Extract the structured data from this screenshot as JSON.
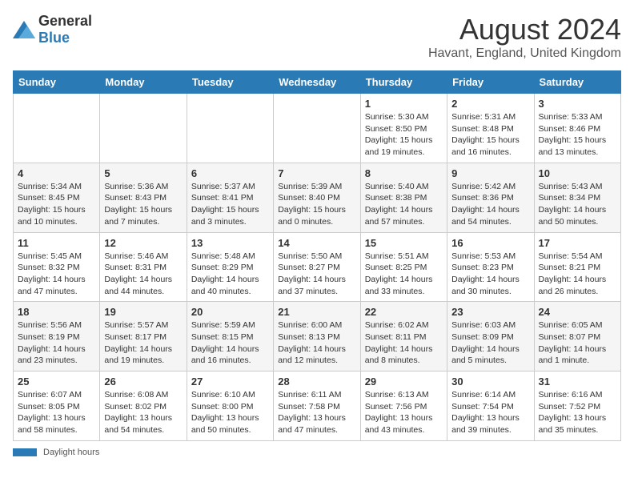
{
  "logo": {
    "general": "General",
    "blue": "Blue"
  },
  "title": "August 2024",
  "location": "Havant, England, United Kingdom",
  "days_of_week": [
    "Sunday",
    "Monday",
    "Tuesday",
    "Wednesday",
    "Thursday",
    "Friday",
    "Saturday"
  ],
  "weeks": [
    [
      {
        "day": "",
        "info": ""
      },
      {
        "day": "",
        "info": ""
      },
      {
        "day": "",
        "info": ""
      },
      {
        "day": "",
        "info": ""
      },
      {
        "day": "1",
        "info": "Sunrise: 5:30 AM\nSunset: 8:50 PM\nDaylight: 15 hours\nand 19 minutes."
      },
      {
        "day": "2",
        "info": "Sunrise: 5:31 AM\nSunset: 8:48 PM\nDaylight: 15 hours\nand 16 minutes."
      },
      {
        "day": "3",
        "info": "Sunrise: 5:33 AM\nSunset: 8:46 PM\nDaylight: 15 hours\nand 13 minutes."
      }
    ],
    [
      {
        "day": "4",
        "info": "Sunrise: 5:34 AM\nSunset: 8:45 PM\nDaylight: 15 hours\nand 10 minutes."
      },
      {
        "day": "5",
        "info": "Sunrise: 5:36 AM\nSunset: 8:43 PM\nDaylight: 15 hours\nand 7 minutes."
      },
      {
        "day": "6",
        "info": "Sunrise: 5:37 AM\nSunset: 8:41 PM\nDaylight: 15 hours\nand 3 minutes."
      },
      {
        "day": "7",
        "info": "Sunrise: 5:39 AM\nSunset: 8:40 PM\nDaylight: 15 hours\nand 0 minutes."
      },
      {
        "day": "8",
        "info": "Sunrise: 5:40 AM\nSunset: 8:38 PM\nDaylight: 14 hours\nand 57 minutes."
      },
      {
        "day": "9",
        "info": "Sunrise: 5:42 AM\nSunset: 8:36 PM\nDaylight: 14 hours\nand 54 minutes."
      },
      {
        "day": "10",
        "info": "Sunrise: 5:43 AM\nSunset: 8:34 PM\nDaylight: 14 hours\nand 50 minutes."
      }
    ],
    [
      {
        "day": "11",
        "info": "Sunrise: 5:45 AM\nSunset: 8:32 PM\nDaylight: 14 hours\nand 47 minutes."
      },
      {
        "day": "12",
        "info": "Sunrise: 5:46 AM\nSunset: 8:31 PM\nDaylight: 14 hours\nand 44 minutes."
      },
      {
        "day": "13",
        "info": "Sunrise: 5:48 AM\nSunset: 8:29 PM\nDaylight: 14 hours\nand 40 minutes."
      },
      {
        "day": "14",
        "info": "Sunrise: 5:50 AM\nSunset: 8:27 PM\nDaylight: 14 hours\nand 37 minutes."
      },
      {
        "day": "15",
        "info": "Sunrise: 5:51 AM\nSunset: 8:25 PM\nDaylight: 14 hours\nand 33 minutes."
      },
      {
        "day": "16",
        "info": "Sunrise: 5:53 AM\nSunset: 8:23 PM\nDaylight: 14 hours\nand 30 minutes."
      },
      {
        "day": "17",
        "info": "Sunrise: 5:54 AM\nSunset: 8:21 PM\nDaylight: 14 hours\nand 26 minutes."
      }
    ],
    [
      {
        "day": "18",
        "info": "Sunrise: 5:56 AM\nSunset: 8:19 PM\nDaylight: 14 hours\nand 23 minutes."
      },
      {
        "day": "19",
        "info": "Sunrise: 5:57 AM\nSunset: 8:17 PM\nDaylight: 14 hours\nand 19 minutes."
      },
      {
        "day": "20",
        "info": "Sunrise: 5:59 AM\nSunset: 8:15 PM\nDaylight: 14 hours\nand 16 minutes."
      },
      {
        "day": "21",
        "info": "Sunrise: 6:00 AM\nSunset: 8:13 PM\nDaylight: 14 hours\nand 12 minutes."
      },
      {
        "day": "22",
        "info": "Sunrise: 6:02 AM\nSunset: 8:11 PM\nDaylight: 14 hours\nand 8 minutes."
      },
      {
        "day": "23",
        "info": "Sunrise: 6:03 AM\nSunset: 8:09 PM\nDaylight: 14 hours\nand 5 minutes."
      },
      {
        "day": "24",
        "info": "Sunrise: 6:05 AM\nSunset: 8:07 PM\nDaylight: 14 hours\nand 1 minute."
      }
    ],
    [
      {
        "day": "25",
        "info": "Sunrise: 6:07 AM\nSunset: 8:05 PM\nDaylight: 13 hours\nand 58 minutes."
      },
      {
        "day": "26",
        "info": "Sunrise: 6:08 AM\nSunset: 8:02 PM\nDaylight: 13 hours\nand 54 minutes."
      },
      {
        "day": "27",
        "info": "Sunrise: 6:10 AM\nSunset: 8:00 PM\nDaylight: 13 hours\nand 50 minutes."
      },
      {
        "day": "28",
        "info": "Sunrise: 6:11 AM\nSunset: 7:58 PM\nDaylight: 13 hours\nand 47 minutes."
      },
      {
        "day": "29",
        "info": "Sunrise: 6:13 AM\nSunset: 7:56 PM\nDaylight: 13 hours\nand 43 minutes."
      },
      {
        "day": "30",
        "info": "Sunrise: 6:14 AM\nSunset: 7:54 PM\nDaylight: 13 hours\nand 39 minutes."
      },
      {
        "day": "31",
        "info": "Sunrise: 6:16 AM\nSunset: 7:52 PM\nDaylight: 13 hours\nand 35 minutes."
      }
    ]
  ],
  "footer": {
    "label": "Daylight hours"
  }
}
